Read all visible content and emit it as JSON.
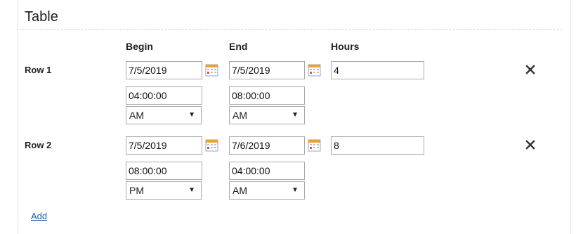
{
  "section": {
    "title": "Table"
  },
  "columns": {
    "begin": "Begin",
    "end": "End",
    "hours": "Hours"
  },
  "rows": [
    {
      "label": "Row 1",
      "begin_date": "7/5/2019",
      "end_date": "7/5/2019",
      "hours": "4",
      "begin_time": "04:00:00",
      "end_time": "08:00:00",
      "begin_ampm": "AM",
      "end_ampm": "AM"
    },
    {
      "label": "Row 2",
      "begin_date": "7/5/2019",
      "end_date": "7/6/2019",
      "hours": "8",
      "begin_time": "08:00:00",
      "end_time": "04:00:00",
      "begin_ampm": "PM",
      "end_ampm": "AM"
    }
  ],
  "actions": {
    "add": "Add"
  },
  "icons": {
    "calendar": "calendar-icon",
    "remove": "close-icon",
    "dropdown": "chevron-down-icon"
  },
  "colors": {
    "link": "#1a5fb4",
    "calendar_accent": "#e8a23a"
  }
}
